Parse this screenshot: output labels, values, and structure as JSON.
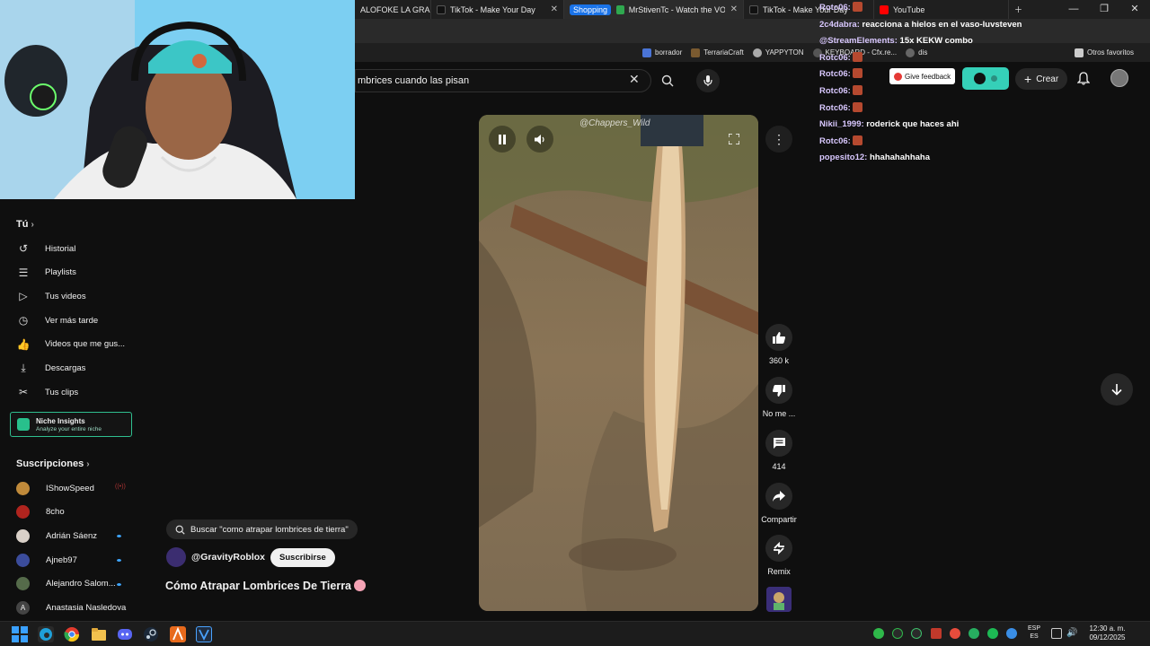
{
  "browser": {
    "tabs": [
      {
        "label": "ALOFOKE LA GRA",
        "color": "#c8a000"
      },
      {
        "label": "TikTok - Make Your Day",
        "color": "#111111"
      },
      {
        "label": "MrStivenTc - Watch the VOD o",
        "color": "#2fa84f",
        "badge": "Shopping"
      },
      {
        "label": "TikTok - Make Your Day",
        "color": "#111111"
      },
      {
        "label": "YouTube",
        "color": "#ff0000"
      }
    ],
    "bookmarks": [
      "borrador",
      "TerrariaCraft",
      "YAPPYTON",
      "KEYBOARD - Cfx.re...",
      "dis"
    ],
    "other_bookmarks": "Otros favoritos"
  },
  "header": {
    "search_value": "mbrices cuando las pisan",
    "give_feedback": "Give feedback",
    "create_label": "Crear"
  },
  "chat": [
    {
      "user": "Rotc06:",
      "msg": "",
      "emote": true
    },
    {
      "user": "2c4dabra:",
      "msg": "reacciona a hielos en el vaso-luvsteven",
      "emote": false
    },
    {
      "user": "@StreamElements:",
      "msg": "15x KEKW combo",
      "emote": false
    },
    {
      "user": "Rotc06:",
      "msg": "",
      "emote": true
    },
    {
      "user": "Rotc06:",
      "msg": "",
      "emote": true
    },
    {
      "user": "Rotc06:",
      "msg": "",
      "emote": true
    },
    {
      "user": "Rotc06:",
      "msg": "",
      "emote": true
    },
    {
      "user": "Nikii_1999:",
      "msg": "roderick que haces ahi",
      "emote": false
    },
    {
      "user": "Rotc06:",
      "msg": "",
      "emote": true
    },
    {
      "user": "popesito12:",
      "msg": "hhahahahhaha",
      "emote": false
    }
  ],
  "sidebar": {
    "you_label": "Tú",
    "items": [
      {
        "label": "Historial",
        "icon": "history-icon"
      },
      {
        "label": "Playlists",
        "icon": "playlist-icon"
      },
      {
        "label": "Tus videos",
        "icon": "your-videos-icon"
      },
      {
        "label": "Ver más tarde",
        "icon": "watch-later-icon"
      },
      {
        "label": "Videos que me gus...",
        "icon": "liked-icon"
      },
      {
        "label": "Descargas",
        "icon": "download-icon"
      },
      {
        "label": "Tus clips",
        "icon": "clips-icon"
      }
    ],
    "niche": {
      "title": "Niche Insights",
      "subtitle": "Analyze your entire niche"
    },
    "subs_label": "Suscripciones",
    "subscriptions": [
      {
        "name": "IShowSpeed",
        "color": "#c08a3a",
        "status": "live"
      },
      {
        "name": "8cho",
        "color": "#b0241e",
        "status": "none"
      },
      {
        "name": "Adrián Sáenz",
        "color": "#d9d0c8",
        "status": "new"
      },
      {
        "name": "Ajneb97",
        "color": "#3b4c9b",
        "status": "new"
      },
      {
        "name": "Alejandro Salom...",
        "color": "#556b4a",
        "status": "new"
      },
      {
        "name": "Anastasia Nasledova",
        "color": "#444444",
        "status": "none",
        "initial": "A"
      }
    ]
  },
  "short": {
    "watermark": "@Chappers_Wild",
    "likes": "360 k",
    "dislike_label": "No me ...",
    "comments": "414",
    "share_label": "Compartir",
    "remix_label": "Remix",
    "search_suggestion": "Buscar \"como atrapar lombrices de tierra\"",
    "channel": "@GravityRoblox",
    "subscribe_label": "Suscribirse",
    "title": "Cómo Atrapar Lombrices De Tierra"
  },
  "taskbar": {
    "lang_top": "ESP",
    "lang_bottom": "ES",
    "time": "12:30 a. m.",
    "date": "09/12/2025"
  }
}
